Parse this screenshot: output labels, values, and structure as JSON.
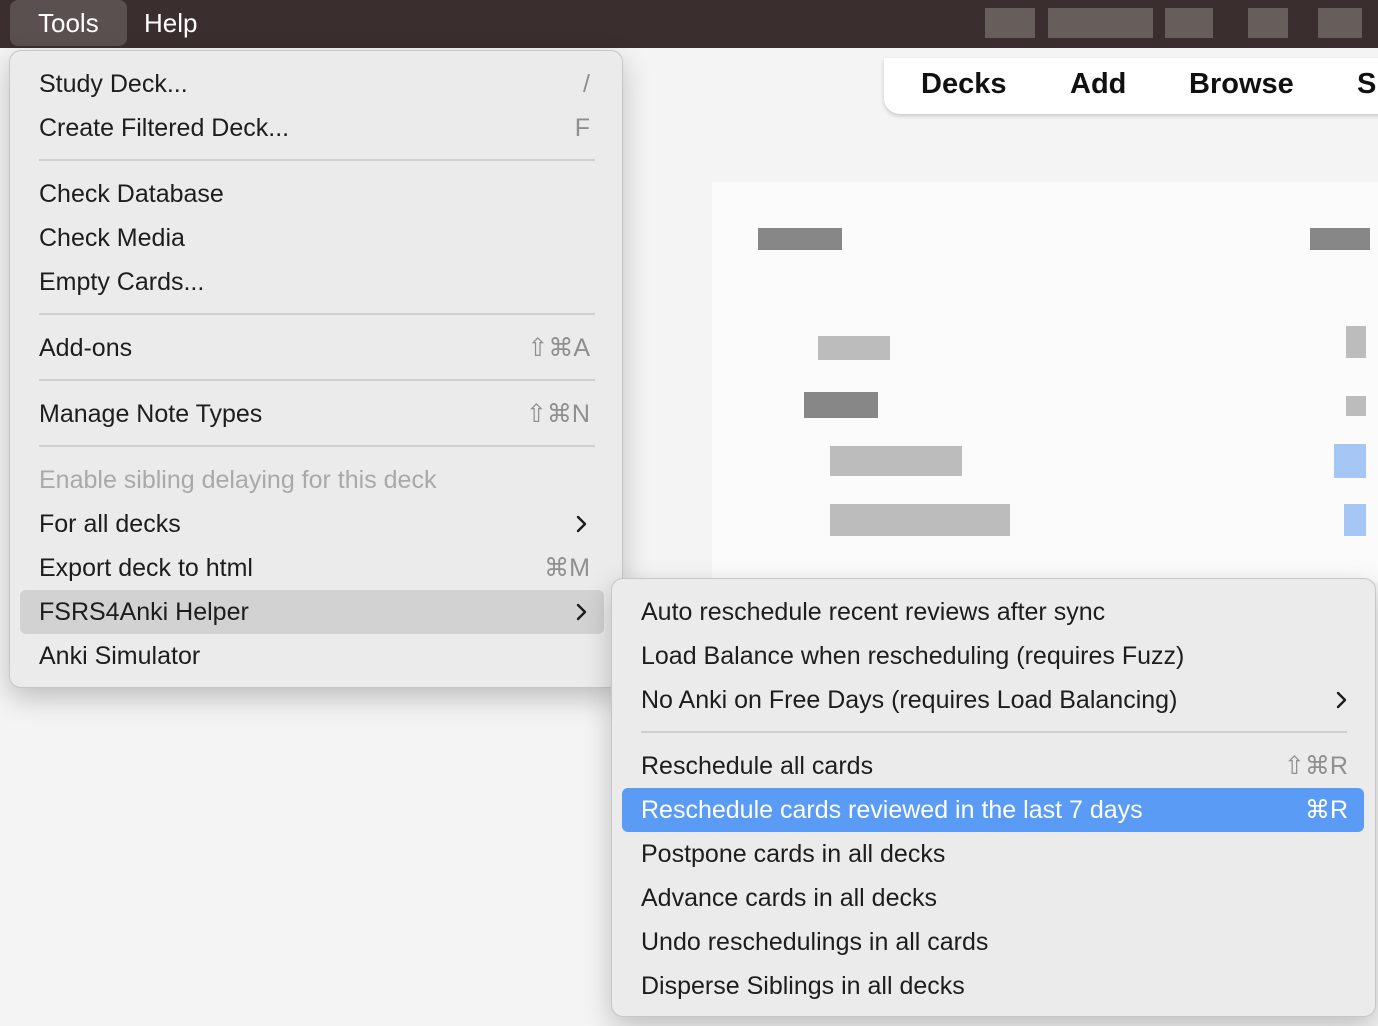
{
  "menubar": {
    "items": [
      "Tools",
      "Help"
    ]
  },
  "toolbar": {
    "items": [
      "Decks",
      "Add",
      "Browse",
      "S"
    ]
  },
  "tools_menu": {
    "items": [
      {
        "label": "Study Deck...",
        "shortcut": "/"
      },
      {
        "label": "Create Filtered Deck...",
        "shortcut": "F"
      },
      {
        "label": "Check Database",
        "shortcut": ""
      },
      {
        "label": "Check Media",
        "shortcut": ""
      },
      {
        "label": "Empty Cards...",
        "shortcut": ""
      },
      {
        "label": "Add-ons",
        "shortcut": "⇧⌘A"
      },
      {
        "label": "Manage Note Types",
        "shortcut": "⇧⌘N"
      },
      {
        "label": "Enable sibling delaying for this deck",
        "shortcut": "",
        "disabled": true
      },
      {
        "label": "For all decks",
        "submenu": true
      },
      {
        "label": "Export deck to html",
        "shortcut": "⌘M"
      },
      {
        "label": "FSRS4Anki Helper",
        "submenu": true,
        "highlighted": true
      },
      {
        "label": "Anki Simulator",
        "shortcut": ""
      }
    ]
  },
  "fsrs_menu": {
    "items": [
      {
        "label": "Auto reschedule recent reviews after sync",
        "shortcut": ""
      },
      {
        "label": "Load Balance when rescheduling (requires Fuzz)",
        "shortcut": ""
      },
      {
        "label": "No Anki on Free Days (requires Load Balancing)",
        "submenu": true
      },
      {
        "label": "Reschedule all cards",
        "shortcut": "⇧⌘R"
      },
      {
        "label": "Reschedule cards reviewed in the last 7 days",
        "shortcut": "⌘R",
        "selected": true
      },
      {
        "label": "Postpone cards in all decks",
        "shortcut": ""
      },
      {
        "label": "Advance cards in all decks",
        "shortcut": ""
      },
      {
        "label": "Undo reschedulings in all cards",
        "shortcut": ""
      },
      {
        "label": "Disperse Siblings in all decks",
        "shortcut": ""
      }
    ]
  },
  "colors": {
    "menubar_bg": "#3a2f2e",
    "selection": "#5a9cf5",
    "menu_bg": "#ebebeb"
  }
}
